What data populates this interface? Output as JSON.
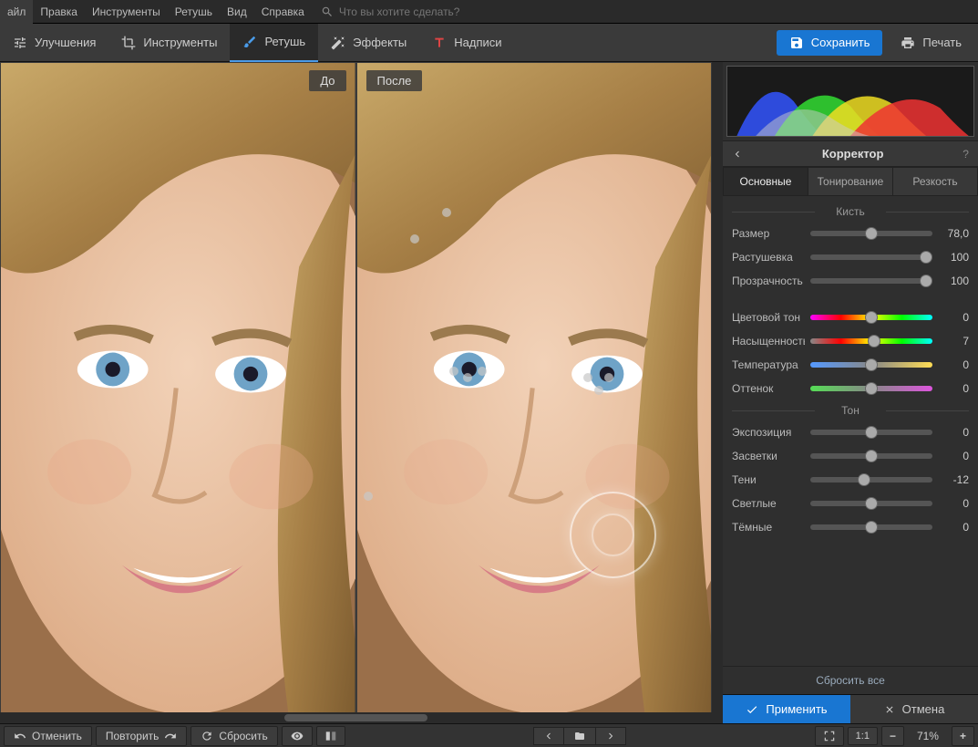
{
  "menu": {
    "items": [
      "айл",
      "Правка",
      "Инструменты",
      "Ретушь",
      "Вид",
      "Справка"
    ],
    "search_placeholder": "Что вы хотите сделать?"
  },
  "toolbar": {
    "tabs": [
      {
        "label": "Улучшения"
      },
      {
        "label": "Инструменты"
      },
      {
        "label": "Ретушь",
        "active": true
      },
      {
        "label": "Эффекты"
      },
      {
        "label": "Надписи"
      }
    ],
    "save": "Сохранить",
    "print": "Печать"
  },
  "canvas": {
    "before": "До",
    "after": "После"
  },
  "panel": {
    "title": "Корректор",
    "tabs": [
      "Основные",
      "Тонирование",
      "Резкость"
    ],
    "active_tab": 0,
    "section_brush": "Кисть",
    "section_tone": "Тон",
    "sliders_brush": [
      {
        "label": "Размер",
        "value": "78,0",
        "pos": 50
      },
      {
        "label": "Растушевка",
        "value": "100",
        "pos": 95
      },
      {
        "label": "Прозрачность",
        "value": "100",
        "pos": 95
      }
    ],
    "sliders_color": [
      {
        "label": "Цветовой тон",
        "value": "0",
        "pos": 50,
        "cls": "hue"
      },
      {
        "label": "Насыщенность",
        "value": "7",
        "pos": 52,
        "cls": "sat"
      },
      {
        "label": "Температура",
        "value": "0",
        "pos": 50,
        "cls": "temp"
      },
      {
        "label": "Оттенок",
        "value": "0",
        "pos": 50,
        "cls": "tint"
      }
    ],
    "sliders_tone": [
      {
        "label": "Экспозиция",
        "value": "0",
        "pos": 50
      },
      {
        "label": "Засветки",
        "value": "0",
        "pos": 50
      },
      {
        "label": "Тени",
        "value": "-12",
        "pos": 44
      },
      {
        "label": "Светлые",
        "value": "0",
        "pos": 50
      },
      {
        "label": "Тёмные",
        "value": "0",
        "pos": 50
      }
    ],
    "reset_all": "Сбросить все",
    "apply": "Применить",
    "cancel": "Отмена"
  },
  "bottom": {
    "undo": "Отменить",
    "redo": "Повторить",
    "reset": "Сбросить",
    "zoom11": "1:1",
    "zoom": "71%"
  }
}
